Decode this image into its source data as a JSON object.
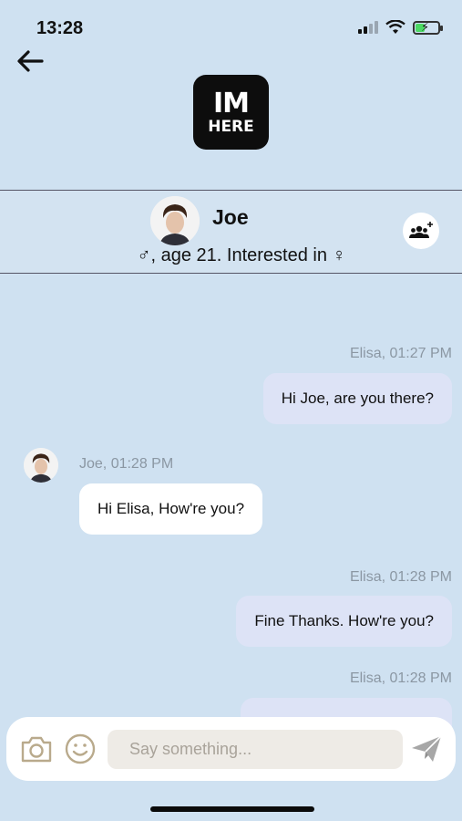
{
  "status_bar": {
    "time": "13:28"
  },
  "app": {
    "logo_line1": "IM",
    "logo_line2": "HERE"
  },
  "profile": {
    "name": "Joe",
    "male_symbol": "♂",
    "info_text": ", age 21. Interested in ",
    "female_symbol": "♀"
  },
  "messages": [
    {
      "sender": "Elisa",
      "time": "01:27 PM",
      "meta": "Elisa,  01:27 PM",
      "text": "Hi Joe, are you there?",
      "direction": "out"
    },
    {
      "sender": "Joe",
      "time": "01:28 PM",
      "meta": "Joe,  01:28 PM",
      "text": "Hi Elisa, How're you?",
      "direction": "in"
    },
    {
      "sender": "Elisa",
      "time": "01:28 PM",
      "meta": "Elisa,  01:28 PM",
      "text": "Fine Thanks. How're you?",
      "direction": "out"
    },
    {
      "sender": "Elisa",
      "time": "01:28 PM",
      "meta": "Elisa,  01:28 PM",
      "text": "",
      "direction": "out"
    }
  ],
  "composer": {
    "placeholder": "Say something..."
  },
  "colors": {
    "background": "#cfe1f1",
    "outgoing_bubble": "#dde3f6",
    "incoming_bubble": "#ffffff",
    "icon_tan": "#b9aa8c"
  }
}
